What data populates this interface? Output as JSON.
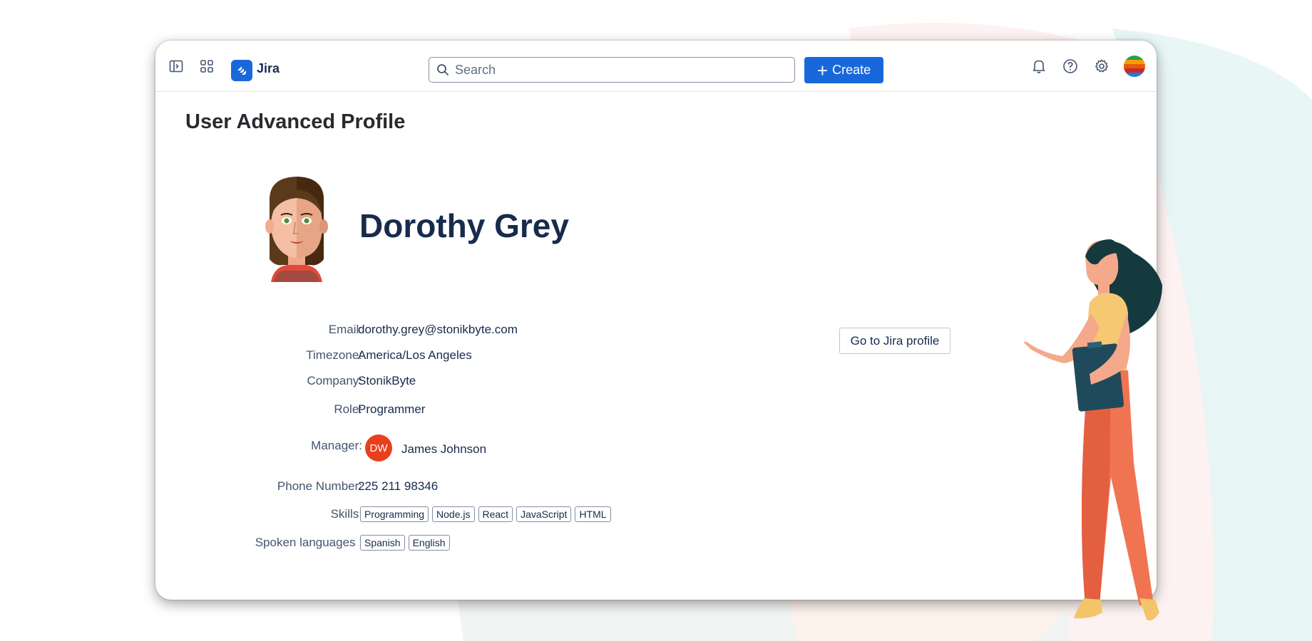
{
  "app": {
    "name": "Jira",
    "brand_color": "#1868db"
  },
  "topbar": {
    "search_placeholder": "Search",
    "create_label": "Create",
    "icons": [
      "sidebar-toggle-icon",
      "app-switcher-icon",
      "jira-logo-icon",
      "bell-icon",
      "help-icon",
      "settings-icon",
      "user-avatar-icon"
    ]
  },
  "page": {
    "title": "User Advanced Profile"
  },
  "profile": {
    "name": "Dorothy Grey",
    "fields": {
      "email": {
        "label": "Email:",
        "value": "dorothy.grey@stonikbyte.com"
      },
      "timezone": {
        "label": "Timezone:",
        "value": "America/Los Angeles"
      },
      "company": {
        "label": "Company:",
        "value": "StonikByte"
      },
      "role": {
        "label": "Role:",
        "value": "Programmer"
      },
      "manager": {
        "label": "Manager:",
        "initials": "DW",
        "value": "James Johnson",
        "avatar_color": "#e8401c"
      },
      "phone": {
        "label": "Phone Number:",
        "value": "225 211 98346"
      },
      "skills": {
        "label": "Skills:",
        "values": [
          "Programming",
          "Node.js",
          "React",
          "JavaScript",
          "HTML"
        ]
      },
      "languages": {
        "label": "Spoken languages :",
        "values": [
          "Spanish",
          "English"
        ]
      }
    },
    "jira_profile_button": "Go to Jira profile"
  }
}
